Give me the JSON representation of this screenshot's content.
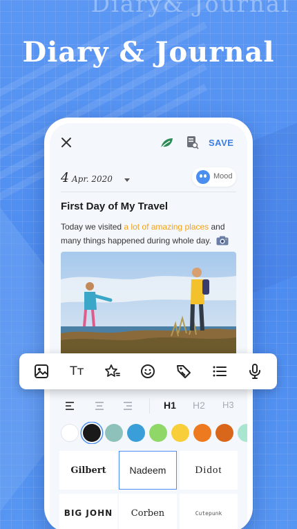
{
  "hero": {
    "ghost_title": "Diary& Journal",
    "title": "Diary & Journal"
  },
  "editor": {
    "save_label": "SAVE",
    "date_day": "4",
    "date_month_year": "Apr. 2020",
    "mood_label": "Mood",
    "entry_title": "First Day of My Travel",
    "body_before": "Today we visited ",
    "body_highlight": "a lot of amazing places",
    "body_after": " and many things happened during whole day.",
    "highlight_color": "#f0a21c",
    "accent_color": "#3b7de0"
  },
  "format_toolbar": {
    "tools": [
      "image-icon",
      "text-size-icon",
      "sticker-star-icon",
      "emoji-icon",
      "tag-icon",
      "bullet-list-icon",
      "microphone-icon"
    ],
    "text_size_glyph": "Tт"
  },
  "paragraph": {
    "headings": [
      "H1",
      "H2",
      "H3"
    ],
    "selected_heading": "H1"
  },
  "colors": {
    "swatches": [
      "#ffffff",
      "#1a1a1a",
      "#8fc1bb",
      "#3a9fd8",
      "#8fd867",
      "#f8cf3a",
      "#ee7a1f",
      "#d9671b",
      "#a8e6cf"
    ],
    "selected": "#1a1a1a"
  },
  "fonts": {
    "options": [
      "Gilbert",
      "Nadeem",
      "Didot",
      "BIG JOHN",
      "Corben",
      "Cutepunk"
    ],
    "selected": "Nadeem"
  }
}
